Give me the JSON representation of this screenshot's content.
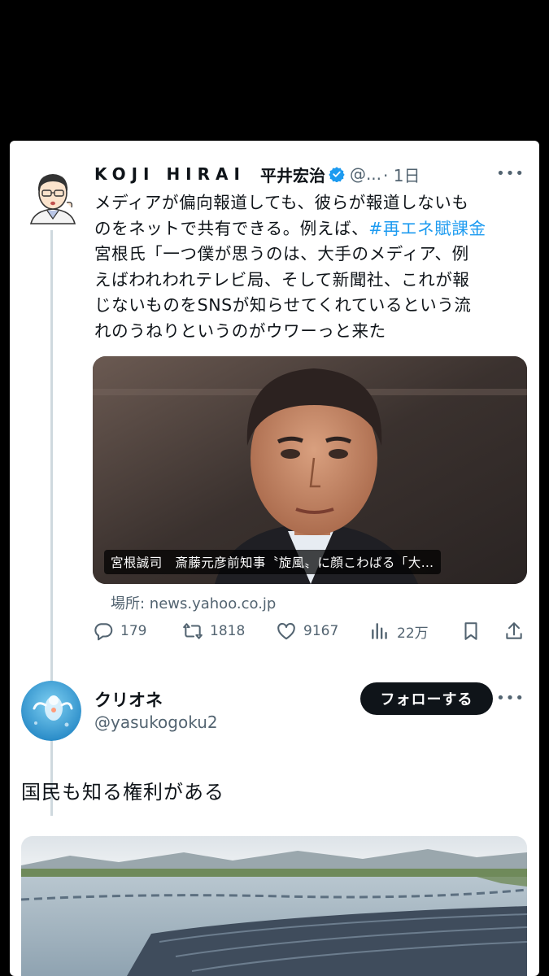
{
  "tweet1": {
    "name_latin": "KOJI HIRAI",
    "name_jp": "平井宏治",
    "handle": "@...",
    "time": "· 1日",
    "text_lines": [
      "メディアが偏向報道しても、彼らが報道しないも",
      "のをネットで共有できる。例えば、",
      "宮根氏「一つ僕が思うのは、大手のメディア、例",
      "えばわれわれテレビ局、そして新聞社、これが報",
      "じないものをSNSが知らせてくれているという流",
      "れのうねりというのがウワーっと来た"
    ],
    "hashtag": "#再エネ賦課金",
    "media_caption": "宮根誠司　斎藤元彦前知事〝旋風〟に顔こわばる「大…",
    "source": "場所: news.yahoo.co.jp",
    "actions": {
      "replies": "179",
      "retweets": "1818",
      "likes": "9167",
      "views": "22万"
    }
  },
  "tweet2": {
    "name": "クリオネ",
    "handle": "@yasukogoku2",
    "follow_label": "フォローする",
    "text": "国民も知る権利がある"
  },
  "colors": {
    "accent": "#1d9bf0",
    "text": "#0f1419",
    "muted": "#536471",
    "button": "#0f1419"
  },
  "icons": [
    "more-icon",
    "verified-icon",
    "reply-icon",
    "retweet-icon",
    "like-icon",
    "views-icon",
    "bookmark-icon",
    "share-icon"
  ]
}
